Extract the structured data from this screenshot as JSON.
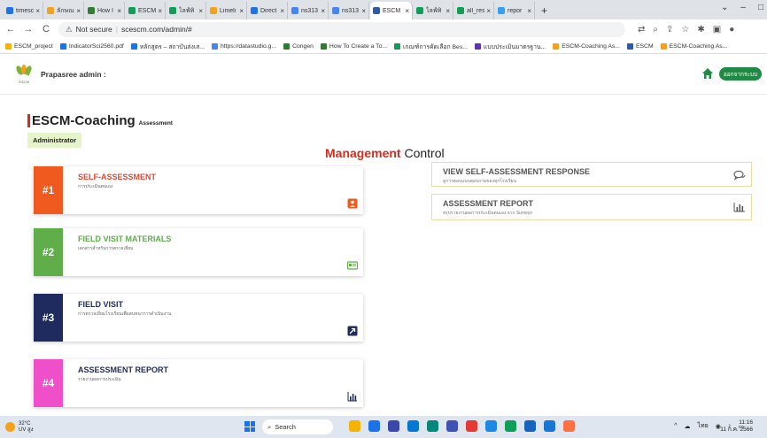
{
  "browser": {
    "tabs": [
      {
        "label": "timesc",
        "color": "#1a73e8"
      },
      {
        "label": "ลักษณ",
        "color": "#f4a21b"
      },
      {
        "label": "How I",
        "color": "#2e7d32"
      },
      {
        "label": "ESCM",
        "color": "#0f9d58"
      },
      {
        "label": "ไลฟ์ทิ",
        "color": "#0f9d58"
      },
      {
        "label": "Limeli",
        "color": "#f4a21b"
      },
      {
        "label": "Direct",
        "color": "#1a73e8"
      },
      {
        "label": "ns313",
        "color": "#4285f4"
      },
      {
        "label": "ns313",
        "color": "#4285f4"
      },
      {
        "label": "ESCM",
        "color": "#2e5aa6",
        "active": true
      },
      {
        "label": "ไลฟ์ทิ",
        "color": "#0f9d58"
      },
      {
        "label": "all_res",
        "color": "#0f9d58"
      },
      {
        "label": "repor",
        "color": "#34a0ef"
      }
    ],
    "new_tab": "+",
    "window_controls": [
      "⌄",
      "–",
      "□"
    ],
    "address": {
      "security": "Not secure",
      "url": "scescm.com/admin/#"
    },
    "bookmarks": [
      {
        "label": "ESCM_project",
        "color": "#f4b400"
      },
      {
        "label": "IndicatorSci2560.pdf",
        "color": "#1a73e8"
      },
      {
        "label": "หลักสูตร – สถาบันส่งเส...",
        "color": "#1a73e8"
      },
      {
        "label": "https://datastudio.g...",
        "color": "#4285f4"
      },
      {
        "label": "Congen",
        "color": "#2e7d32"
      },
      {
        "label": "How To Create a To...",
        "color": "#2e7d32"
      },
      {
        "label": "เกณฑ์การคัดเลือก Bes...",
        "color": "#0f9d58"
      },
      {
        "label": "แบบประเมินมาตรฐาน...",
        "color": "#5e35b1"
      },
      {
        "label": "ESCM-Coaching As...",
        "color": "#f4a21b"
      },
      {
        "label": "ESCM",
        "color": "#2e5aa6"
      },
      {
        "label": "ESCM-Coaching As...",
        "color": "#f4a21b"
      }
    ]
  },
  "header": {
    "admin_label": "Prapasree admin :",
    "logo_text": "ESCM",
    "logout_label": "ออกจากระบบ"
  },
  "brand": {
    "title": "ESCM-Coaching",
    "subtitle": "Assessment",
    "role": "Administrator"
  },
  "management": {
    "accent": "Management",
    "rest": " Control"
  },
  "cards": [
    {
      "num": "#1",
      "title": "SELF-ASSESSMENT",
      "subtitle": "การประเมินตนเอง",
      "color": "#f05a1e",
      "title_color": "#e8442e",
      "icon": "person-badge-icon"
    },
    {
      "num": "#2",
      "title": "FIELD VISIT MATERIALS",
      "subtitle": "เอกสารสำหรับการตรวจเยี่ยม",
      "color": "#5fae4a",
      "title_color": "#5fae4a",
      "icon": "id-card-icon"
    },
    {
      "num": "#3",
      "title": "FIELD VISIT",
      "subtitle": "การตรวจเยี่ยมโรงเรียนเพื่อสนทนาการดำเนินงาน",
      "color": "#1f2a5e",
      "title_color": "#1f2a5e",
      "icon": "arrow-out-icon"
    },
    {
      "num": "#4",
      "title": "ASSESSMENT REPORT",
      "subtitle": "รายงานผลการประเมิน",
      "color": "#ef4fc8",
      "title_color": "#1f2a5e",
      "icon": "bar-chart-icon"
    }
  ],
  "right_cards": [
    {
      "title": "VIEW SELF-ASSESSMENT RESPONSE",
      "subtitle": "ดูการตอบแบบสอบถามของทุกโรงเรียน",
      "icon": "chat-icon"
    },
    {
      "title": "ASSESSMENT REPORT",
      "subtitle": "สรุปรายงานผลการประเมินตนเอง จาก Surveys",
      "icon": "bar-chart-icon"
    }
  ],
  "taskbar": {
    "temp": "32°C",
    "weather_desc": "UV สูง",
    "search": "Search",
    "lang": "ไทย",
    "time": "11:16",
    "date": "11 ก.ค. 2566",
    "apps": [
      "#f4b400",
      "#1a73e8",
      "#3949ab",
      "#0078d4",
      "#00897b",
      "#3f51b5",
      "#e53935",
      "#1e88e5",
      "#0f9d58",
      "#1565c0",
      "#1976d2",
      "#ff7043"
    ]
  }
}
